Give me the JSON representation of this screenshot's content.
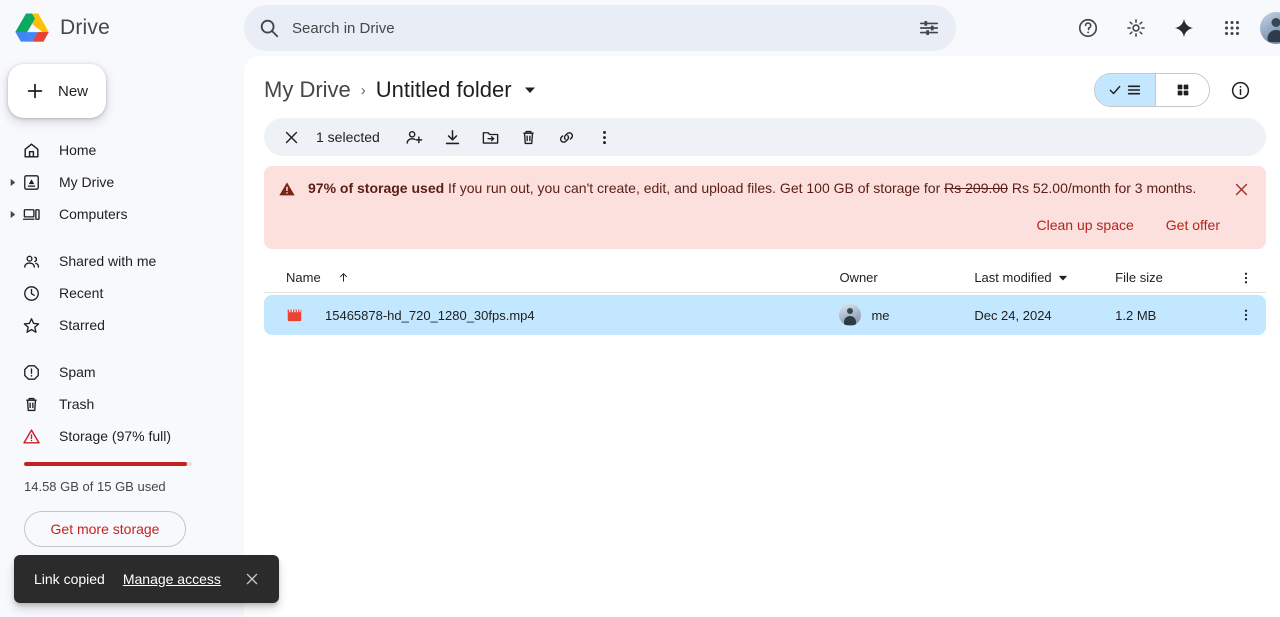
{
  "app": {
    "product_name": "Drive",
    "logo_icon": "drive-logo",
    "colors": {
      "brand_green": "#0da960",
      "brand_yellow": "#ffc107",
      "brand_blue": "#4285f4",
      "brand_red": "#ea4335",
      "selection_blue": "#c2e7ff",
      "banner_bg": "#fbe0dd",
      "banner_text": "#5c1d17",
      "storage_red": "#c5221f",
      "toast_bg": "#2b2b2b"
    }
  },
  "search": {
    "placeholder": "Search in Drive",
    "value": "",
    "search_icon": "search-icon",
    "options_icon": "search-options-icon"
  },
  "topbar": {
    "help_icon": "help-icon",
    "settings_icon": "gear-icon",
    "gemini_icon": "sparkle-icon",
    "apps_icon": "apps-grid-icon",
    "avatar": "account-avatar"
  },
  "sidebar": {
    "new_button": {
      "label": "New",
      "icon": "plus-icon"
    },
    "items": [
      {
        "label": "Home",
        "icon": "home-icon",
        "expandable": false
      },
      {
        "label": "My Drive",
        "icon": "my-drive-icon",
        "expandable": true
      },
      {
        "label": "Computers",
        "icon": "computers-icon",
        "expandable": true
      },
      {
        "label": "Shared with me",
        "icon": "people-icon",
        "expandable": false
      },
      {
        "label": "Recent",
        "icon": "clock-icon",
        "expandable": false
      },
      {
        "label": "Starred",
        "icon": "star-icon",
        "expandable": false
      },
      {
        "label": "Spam",
        "icon": "spam-icon",
        "expandable": false
      },
      {
        "label": "Trash",
        "icon": "trash-icon",
        "expandable": false
      },
      {
        "label": "Storage (97% full)",
        "icon": "storage-warning-icon",
        "expandable": false
      }
    ],
    "storage": {
      "percent_used": 97,
      "usage_text": "14.58 GB of 15 GB used",
      "button_label": "Get more storage"
    }
  },
  "breadcrumb": {
    "root": "My Drive",
    "separator": "›",
    "current": "Untitled folder",
    "caret_icon": "chevron-down-icon"
  },
  "view_controls": {
    "list_view_icon": "list-view-icon",
    "grid_view_icon": "grid-view-icon",
    "active": "list",
    "details_icon": "info-icon"
  },
  "selection_toolbar": {
    "close_icon": "close-icon",
    "count_label": "1 selected",
    "actions": [
      {
        "name": "share",
        "icon": "person-add-icon"
      },
      {
        "name": "download",
        "icon": "download-icon"
      },
      {
        "name": "move",
        "icon": "move-to-folder-icon"
      },
      {
        "name": "remove",
        "icon": "trash-icon"
      },
      {
        "name": "copy-link",
        "icon": "link-icon"
      },
      {
        "name": "more",
        "icon": "more-vert-icon"
      }
    ]
  },
  "banner": {
    "warning_icon": "warning-triangle-icon",
    "headline": "97% of storage used",
    "body_pre": "If you run out, you can't create, edit, and upload files. Get 100 GB of storage for",
    "price_old": "Rs 209.00",
    "price_new": "Rs 52.00/month for 3 months.",
    "actions": [
      {
        "label": "Clean up space"
      },
      {
        "label": "Get offer"
      }
    ],
    "close_icon": "close-icon"
  },
  "file_table": {
    "columns": {
      "name": "Name",
      "name_sort_icon": "arrow-up-icon",
      "owner": "Owner",
      "modified": "Last modified",
      "modified_sort_icon": "chevron-down-icon",
      "size": "File size",
      "more_icon": "more-vert-icon"
    },
    "rows": [
      {
        "file_icon": "video-file-icon",
        "name": "15465878-hd_720_1280_30fps.mp4",
        "owner": "me",
        "owner_avatar": "owner-avatar",
        "modified": "Dec 24, 2024",
        "size": "1.2 MB",
        "selected": true,
        "row_more_icon": "more-vert-icon"
      }
    ]
  },
  "toast": {
    "message": "Link copied",
    "action_label": "Manage access",
    "close_icon": "close-icon"
  }
}
